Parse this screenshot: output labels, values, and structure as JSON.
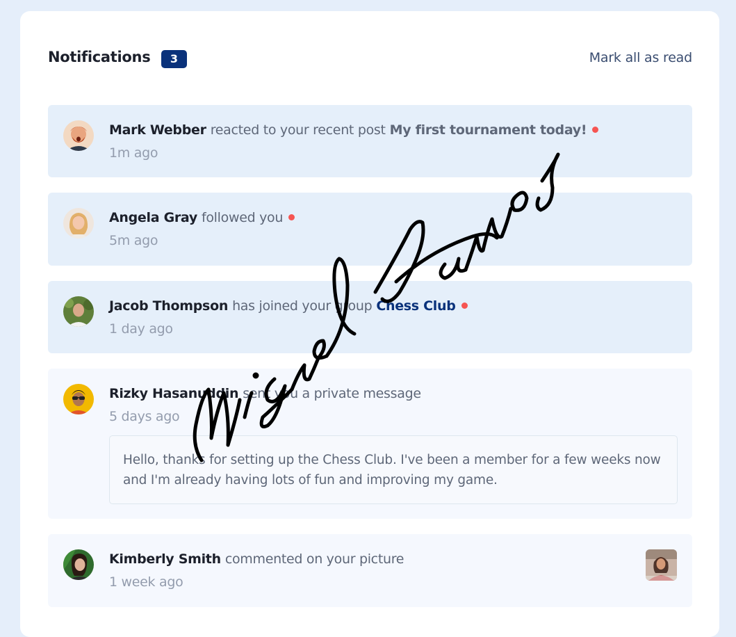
{
  "header": {
    "title": "Notifications",
    "unread_count": "3",
    "mark_all_label": "Mark all as read"
  },
  "notifications": [
    {
      "name": "Mark Webber",
      "action": "reacted to your recent post",
      "target": "My first tournament today!",
      "time": "1m ago",
      "unread": true,
      "avatar_icon": "mark-webber-avatar"
    },
    {
      "name": "Angela Gray",
      "action": "followed you",
      "time": "5m ago",
      "unread": true,
      "avatar_icon": "angela-gray-avatar"
    },
    {
      "name": "Jacob Thompson",
      "action": "has joined your group",
      "target": "Chess Club",
      "time": "1 day ago",
      "unread": true,
      "avatar_icon": "jacob-thompson-avatar"
    },
    {
      "name": "Rizky Hasanuddin",
      "action": "sent you a private message",
      "time": "5 days ago",
      "unread": false,
      "message": "Hello, thanks for setting up the Chess Club. I've been a member for a few weeks now and I'm already having lots of fun and improving my game.",
      "avatar_icon": "rizky-hasanuddin-avatar"
    },
    {
      "name": "Kimberly Smith",
      "action": "commented on your picture",
      "time": "1 week ago",
      "unread": false,
      "avatar_icon": "kimberly-smith-avatar",
      "thumbnail_icon": "commented-picture-thumbnail"
    }
  ],
  "signature": {
    "text": "Miguel Ramos"
  },
  "colors": {
    "page_bg": "#e5eefa",
    "card_bg": "#ffffff",
    "badge_bg": "#0a327b",
    "unread_bg": "#e5effa",
    "read_bg": "#f5f8fe",
    "unread_dot": "#f65552",
    "group_link": "#0a327b"
  }
}
